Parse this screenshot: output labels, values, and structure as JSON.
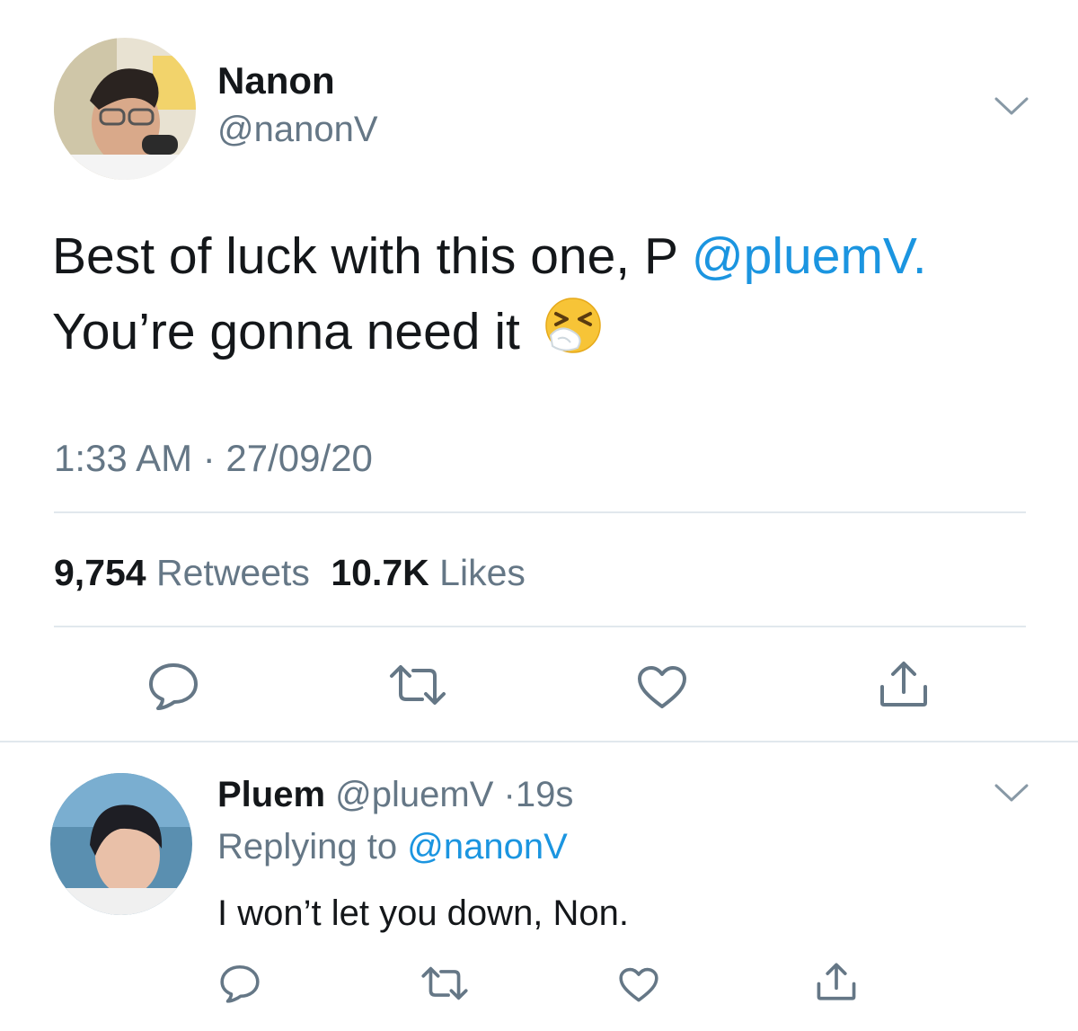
{
  "tweet": {
    "author": {
      "name": "Nanon",
      "handle": "@nanonV"
    },
    "text": {
      "line1_prefix": "Best of luck with this one, P ",
      "line1_mention": "@pluemV.",
      "line2": "You’re gonna need it",
      "emoji": "sneezing-face"
    },
    "timestamp": "1:33 AM · 27/09/20",
    "stats": {
      "retweets_count": "9,754",
      "retweets_label": "Retweets",
      "likes_count": "10.7K",
      "likes_label": "Likes"
    },
    "actions": [
      "reply-icon",
      "retweet-icon",
      "like-icon",
      "share-icon"
    ]
  },
  "reply": {
    "author": {
      "name": "Pluem",
      "handle": "@pluemV",
      "separator": "·",
      "age": "19s"
    },
    "replying_to_label": "Replying to",
    "replying_to_handle": "@nanonV",
    "text": "I won’t let you down, Non.",
    "actions": [
      "reply-icon",
      "retweet-icon",
      "like-icon",
      "share-icon"
    ]
  },
  "colors": {
    "link": "#1b95e0",
    "secondary_text": "#657786",
    "primary_text": "#14171a",
    "divider": "#e1e8ed"
  }
}
